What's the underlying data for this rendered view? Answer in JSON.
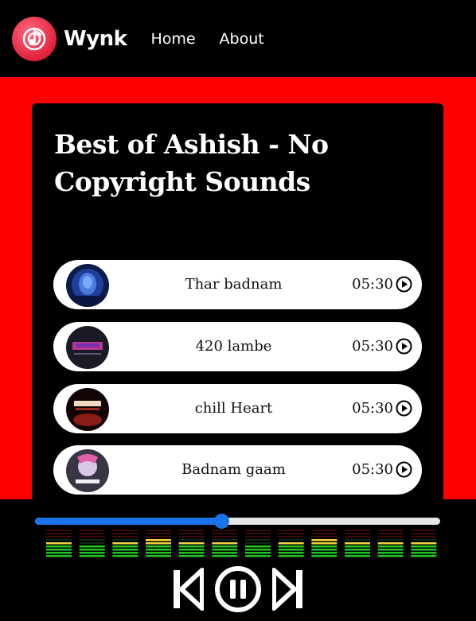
{
  "app": {
    "brand": "Wynk",
    "nav": [
      {
        "label": "Home"
      },
      {
        "label": "About"
      }
    ],
    "logo_icon": "music-note-icon",
    "accent_color": "#ff0000"
  },
  "playlist": {
    "title": "Best of Ashish - No Copyright Sounds",
    "songs": [
      {
        "name": "Thar badnam",
        "duration": "05:30",
        "cover_colors": [
          "#1b2a6b",
          "#3b78d8"
        ]
      },
      {
        "name": "420 lambe",
        "duration": "05:30",
        "cover_colors": [
          "#20202c",
          "#d23fa0"
        ]
      },
      {
        "name": "chill Heart",
        "duration": "05:30",
        "cover_colors": [
          "#160606",
          "#c0302a"
        ]
      },
      {
        "name": "Badnam gaam",
        "duration": "05:30",
        "cover_colors": [
          "#2a2035",
          "#e05fa8"
        ]
      }
    ]
  },
  "player": {
    "progress": 0.46,
    "seek_color": "#1a73e8",
    "equalizer_levels": [
      0.55,
      0.45,
      0.6,
      0.7,
      0.5,
      0.55,
      0.45,
      0.6,
      0.7,
      0.55,
      0.5,
      0.6
    ],
    "controls": [
      "previous-icon",
      "pause-icon",
      "next-icon"
    ]
  }
}
